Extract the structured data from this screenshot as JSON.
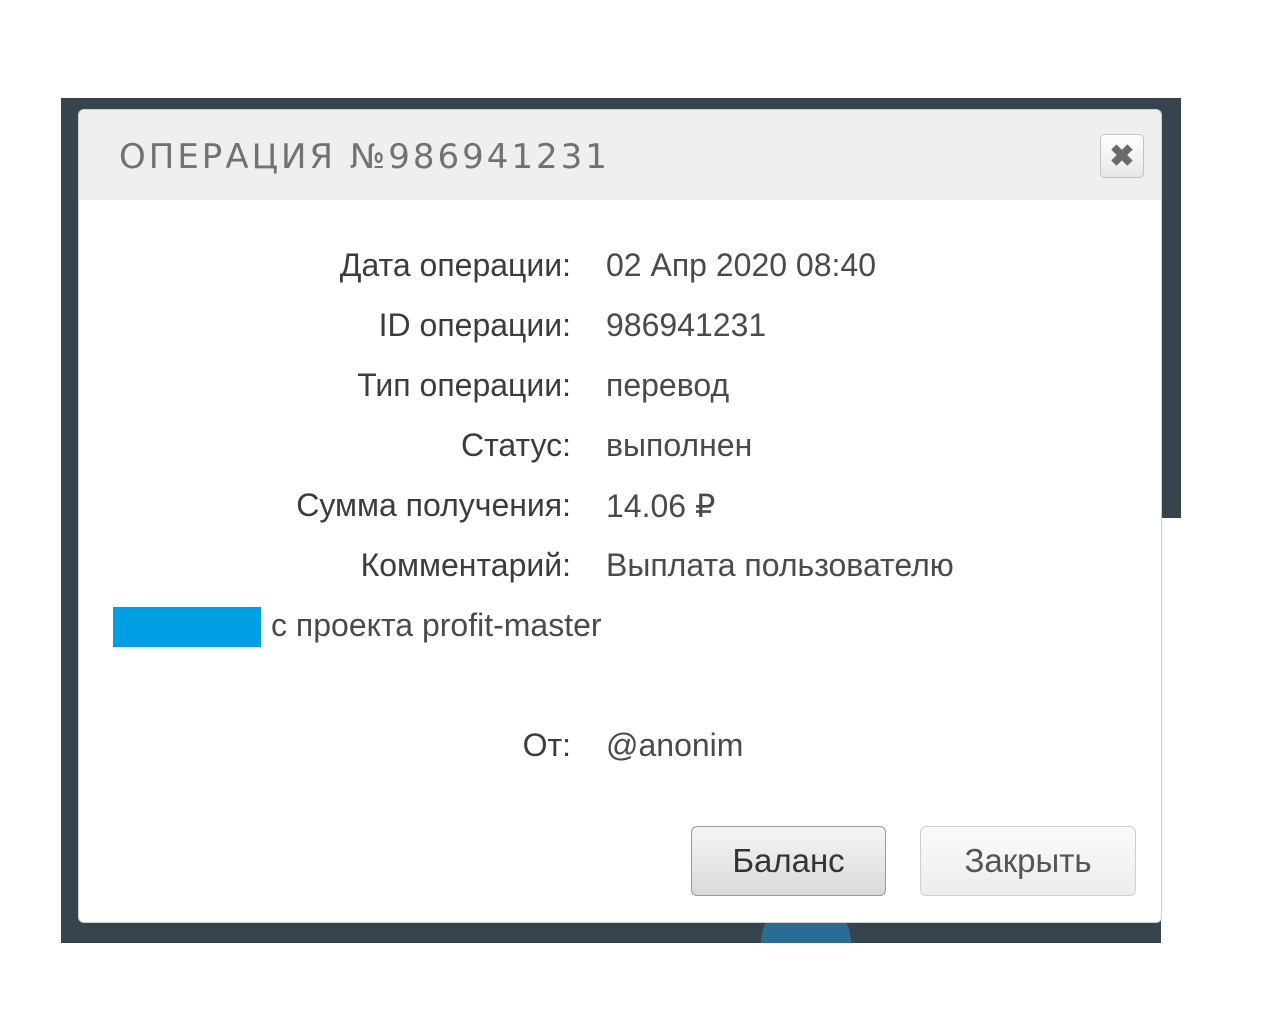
{
  "dialog": {
    "title": "ОПЕРАЦИЯ №986941231",
    "close_icon": "✖"
  },
  "details": [
    {
      "label": "Дата операции:",
      "value": "02 Апр 2020 08:40"
    },
    {
      "label": "ID операции:",
      "value": "986941231"
    },
    {
      "label": "Тип операции:",
      "value": "перевод"
    },
    {
      "label": "Статус:",
      "value": "выполнен"
    },
    {
      "label": "Сумма получения:",
      "value": "14.06 ₽"
    },
    {
      "label": "Комментарий:",
      "value": "Выплата пользователю"
    }
  ],
  "comment_continuation": "с проекта profit-master",
  "sender": {
    "label": "От:",
    "value": "@anonim"
  },
  "buttons": {
    "balance": "Баланс",
    "close": "Закрыть"
  },
  "colors": {
    "redaction": "#009fe3",
    "backdrop": "#37434d"
  }
}
